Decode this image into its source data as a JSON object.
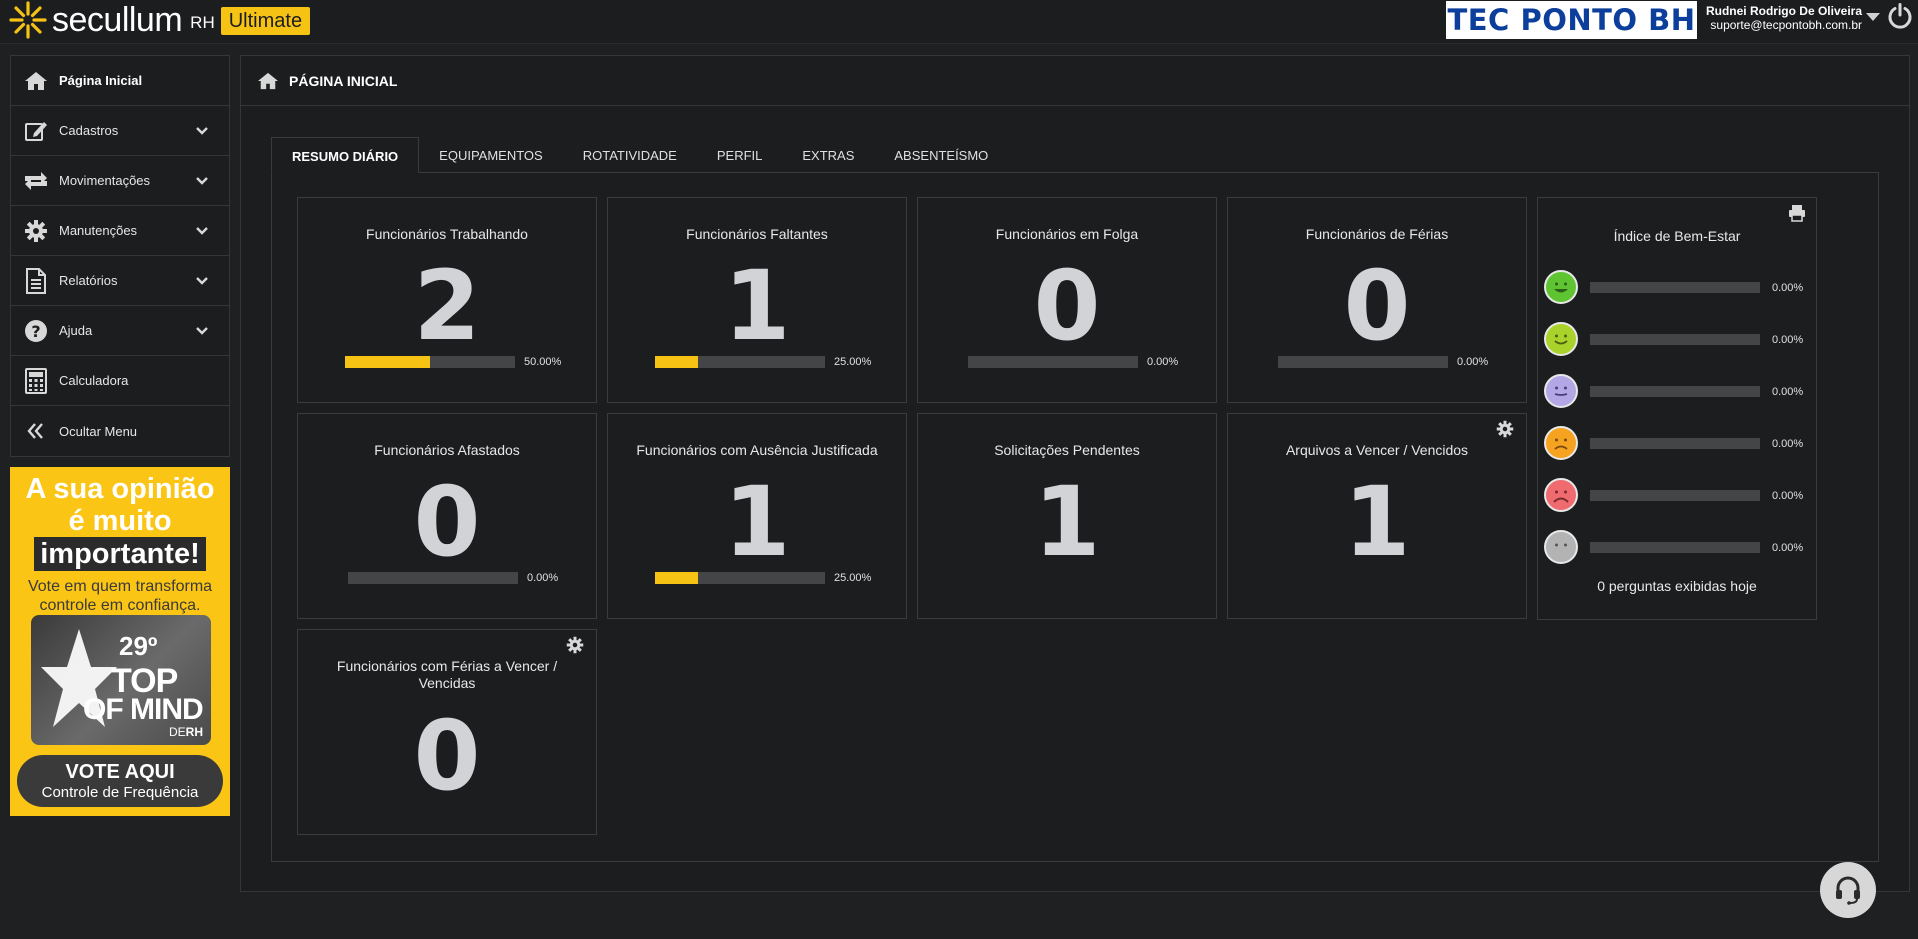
{
  "header": {
    "brand_name": "secullum",
    "brand_suffix": "RH",
    "brand_edition": "Ultimate",
    "company_logo_text": "TEC PONTO BH",
    "user_name": "Rudnei Rodrigo De Oliveira",
    "user_email": "suporte@tecpontobh.com.br",
    "accent_color": "#f6c315"
  },
  "sidebar": {
    "items": [
      {
        "label": "Página Inicial",
        "icon": "home-icon"
      },
      {
        "label": "Cadastros",
        "icon": "edit-icon"
      },
      {
        "label": "Movimentações",
        "icon": "exchange-icon"
      },
      {
        "label": "Manutenções",
        "icon": "gear-icon"
      },
      {
        "label": "Relatórios",
        "icon": "document-icon"
      },
      {
        "label": "Ajuda",
        "icon": "question-icon"
      },
      {
        "label": "Calculadora",
        "icon": "calculator-icon"
      },
      {
        "label": "Ocultar Menu",
        "icon": "double-chevron-left-icon"
      }
    ]
  },
  "banner": {
    "line1": "A sua opinião",
    "line2": "é muito",
    "line3": "importante!",
    "subtitle": "Vote em quem transforma controle em confiança.",
    "badge_number": "29º",
    "badge_top": "TOP",
    "badge_of_mind": "OF MIND",
    "badge_de": "DE",
    "badge_rh": "RH",
    "vote_label": "VOTE AQUI",
    "vote_sub": "Controle de Frequência"
  },
  "main": {
    "title": "PÁGINA INICIAL",
    "tabs": [
      {
        "label": "RESUMO DIÁRIO",
        "active": true
      },
      {
        "label": "EQUIPAMENTOS",
        "active": false
      },
      {
        "label": "ROTATIVIDADE",
        "active": false
      },
      {
        "label": "PERFIL",
        "active": false
      },
      {
        "label": "EXTRAS",
        "active": false
      },
      {
        "label": "ABSENTEÍSMO",
        "active": false
      }
    ],
    "cards": {
      "trabalhando": {
        "title": "Funcionários Trabalhando",
        "value": "2",
        "percent": "50.00%",
        "fraction": 0.5
      },
      "faltantes": {
        "title": "Funcionários Faltantes",
        "value": "1",
        "percent": "25.00%",
        "fraction": 0.25
      },
      "folga": {
        "title": "Funcionários em Folga",
        "value": "0",
        "percent": "0.00%",
        "fraction": 0
      },
      "ferias": {
        "title": "Funcionários de Férias",
        "value": "0",
        "percent": "0.00%",
        "fraction": 0
      },
      "afastados": {
        "title": "Funcionários Afastados",
        "value": "0",
        "percent": "0.00%",
        "fraction": 0
      },
      "ausencia": {
        "title": "Funcionários com Ausência Justificada",
        "value": "1",
        "percent": "25.00%",
        "fraction": 0.25
      },
      "solicitacoes": {
        "title": "Solicitações Pendentes",
        "value": "1"
      },
      "arquivos": {
        "title": "Arquivos a Vencer / Vencidos",
        "value": "1"
      },
      "ferias_vencer": {
        "title_l1": "Funcionários com Férias a Vencer /",
        "title_l2": "Vencidas",
        "value": "0"
      }
    },
    "wellbeing": {
      "title": "Índice de Bem-Estar",
      "rows": [
        {
          "color": "#5ec431",
          "percent": "0.00%"
        },
        {
          "color": "#a9d22b",
          "percent": "0.00%"
        },
        {
          "color": "#b4a7e6",
          "percent": "0.00%"
        },
        {
          "color": "#f5a320",
          "percent": "0.00%"
        },
        {
          "color": "#ef6b6f",
          "percent": "0.00%"
        },
        {
          "color": "#b3b3b3",
          "percent": "0.00%"
        }
      ],
      "footer": "0 perguntas exibidas hoje"
    }
  }
}
